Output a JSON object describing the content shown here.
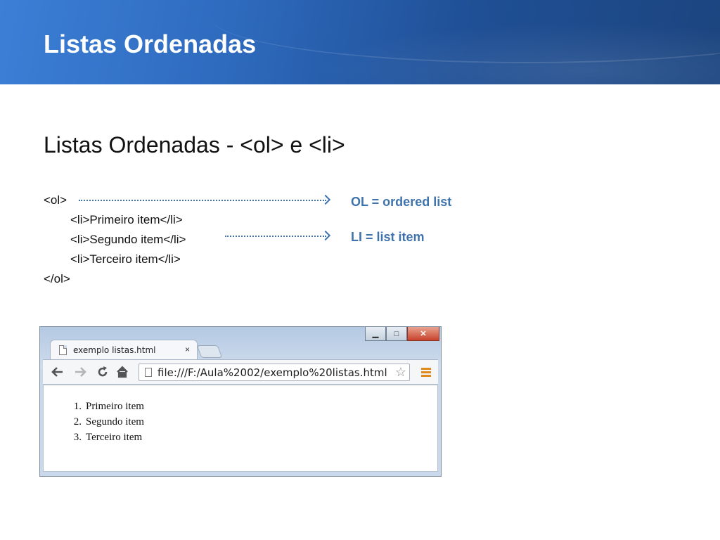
{
  "header": {
    "title": "Listas Ordenadas"
  },
  "subtitle": "Listas Ordenadas - <ol> e <li>",
  "code": {
    "ol_open": "<ol>",
    "li_1": "<li>Primeiro item</li>",
    "li_2": "<li>Segundo item</li>",
    "li_3": "<li>Terceiro item</li>",
    "ol_close": "</ol>"
  },
  "annotations": {
    "ol": "OL = ordered list",
    "li": "LI = list item"
  },
  "colors": {
    "header": "#2f6cc0",
    "annotation": "#3f73ad"
  },
  "browser": {
    "tab_title": "exemplo listas.html",
    "tab_close": "×",
    "url": "file:///F:/Aula%2002/exemplo%20listas.html",
    "icons": [
      "back-arrow-icon",
      "forward-arrow-icon",
      "reload-icon",
      "home-icon",
      "page-icon",
      "star-icon",
      "menu-icon"
    ],
    "window_controls": {
      "minimize": "▁",
      "maximize": "□",
      "close": "✕"
    },
    "list": [
      {
        "num": "1.",
        "text": "Primeiro item"
      },
      {
        "num": "2.",
        "text": "Segundo item"
      },
      {
        "num": "3.",
        "text": "Terceiro item"
      }
    ]
  }
}
